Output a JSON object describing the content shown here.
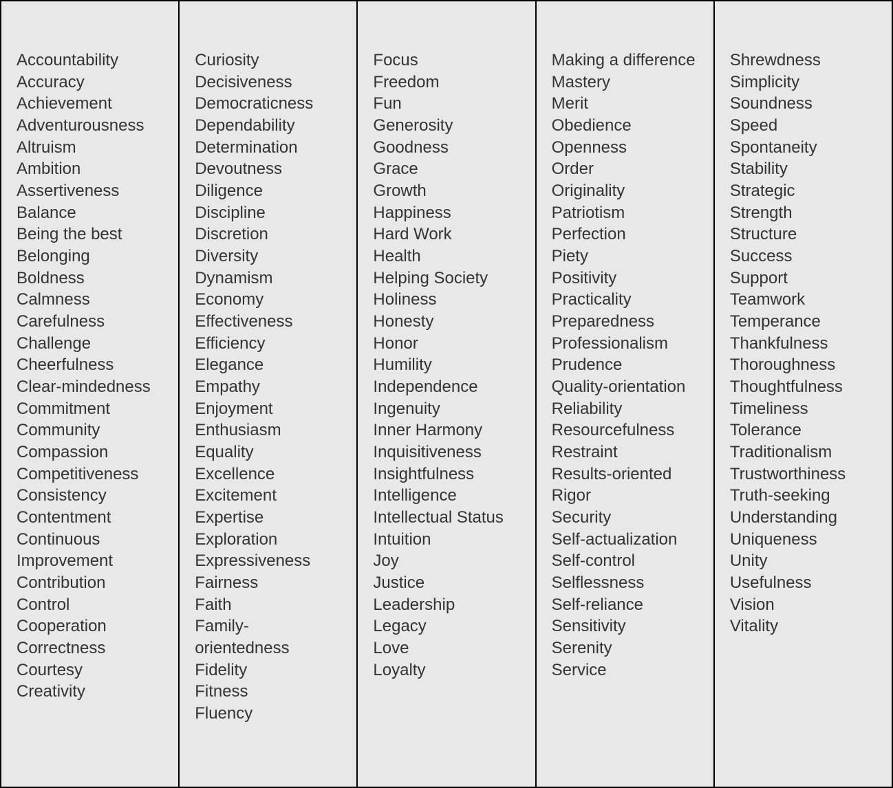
{
  "columns": [
    {
      "items": [
        "Accountability",
        "Accuracy",
        "Achievement",
        "Adventurousness",
        "Altruism",
        "Ambition",
        "Assertiveness",
        "Balance",
        "Being the best",
        "Belonging",
        "Boldness",
        "Calmness",
        "Carefulness",
        "Challenge",
        "Cheerfulness",
        "Clear-mindedness",
        "Commitment",
        "Community",
        "Compassion",
        "Competitiveness",
        "Consistency",
        "Contentment",
        "Continuous Improvement",
        "Contribution",
        "Control",
        "Cooperation",
        "Correctness",
        "Courtesy",
        "Creativity"
      ]
    },
    {
      "items": [
        "Curiosity",
        "Decisiveness",
        "Democraticness",
        "Dependability",
        "Determination",
        "Devoutness",
        "Diligence",
        "Discipline",
        "Discretion",
        "Diversity",
        "Dynamism",
        "Economy",
        "Effectiveness",
        "Efficiency",
        "Elegance",
        "Empathy",
        "Enjoyment",
        "Enthusiasm",
        "Equality",
        "Excellence",
        "Excitement",
        "Expertise",
        "Exploration",
        "Expressiveness",
        "Fairness",
        "Faith",
        "Family-orientedness",
        "Fidelity",
        "Fitness",
        "Fluency"
      ]
    },
    {
      "items": [
        "Focus",
        "Freedom",
        "Fun",
        "Generosity",
        "Goodness",
        "Grace",
        "Growth",
        "Happiness",
        "Hard Work",
        "Health",
        "Helping Society",
        "Holiness",
        "Honesty",
        "Honor",
        "Humility",
        "Independence",
        "Ingenuity",
        "Inner Harmony",
        "Inquisitiveness",
        "Insightfulness",
        "Intelligence",
        "Intellectual Status",
        "Intuition",
        "Joy",
        "Justice",
        "Leadership",
        "Legacy",
        "Love",
        "Loyalty"
      ]
    },
    {
      "items": [
        "Making a difference",
        "Mastery",
        "Merit",
        "Obedience",
        "Openness",
        "Order",
        "Originality",
        "Patriotism",
        "Perfection",
        "Piety",
        "Positivity",
        "Practicality",
        "Preparedness",
        "Professionalism",
        "Prudence",
        "Quality-orientation",
        "Reliability",
        "Resourcefulness",
        "Restraint",
        "Results-oriented",
        "Rigor",
        "Security",
        "Self-actualization",
        "Self-control",
        "Selflessness",
        "Self-reliance",
        "Sensitivity",
        "Serenity",
        "Service"
      ]
    },
    {
      "items": [
        "Shrewdness",
        "Simplicity",
        "Soundness",
        "Speed",
        "Spontaneity",
        "Stability",
        "Strategic",
        "Strength",
        "Structure",
        "Success",
        "Support",
        "Teamwork",
        "Temperance",
        "Thankfulness",
        "Thoroughness",
        "Thoughtfulness",
        "Timeliness",
        "Tolerance",
        "Traditionalism",
        "Trustworthiness",
        "Truth-seeking",
        "Understanding",
        "Uniqueness",
        "Unity",
        "Usefulness",
        "Vision",
        "Vitality"
      ]
    }
  ]
}
